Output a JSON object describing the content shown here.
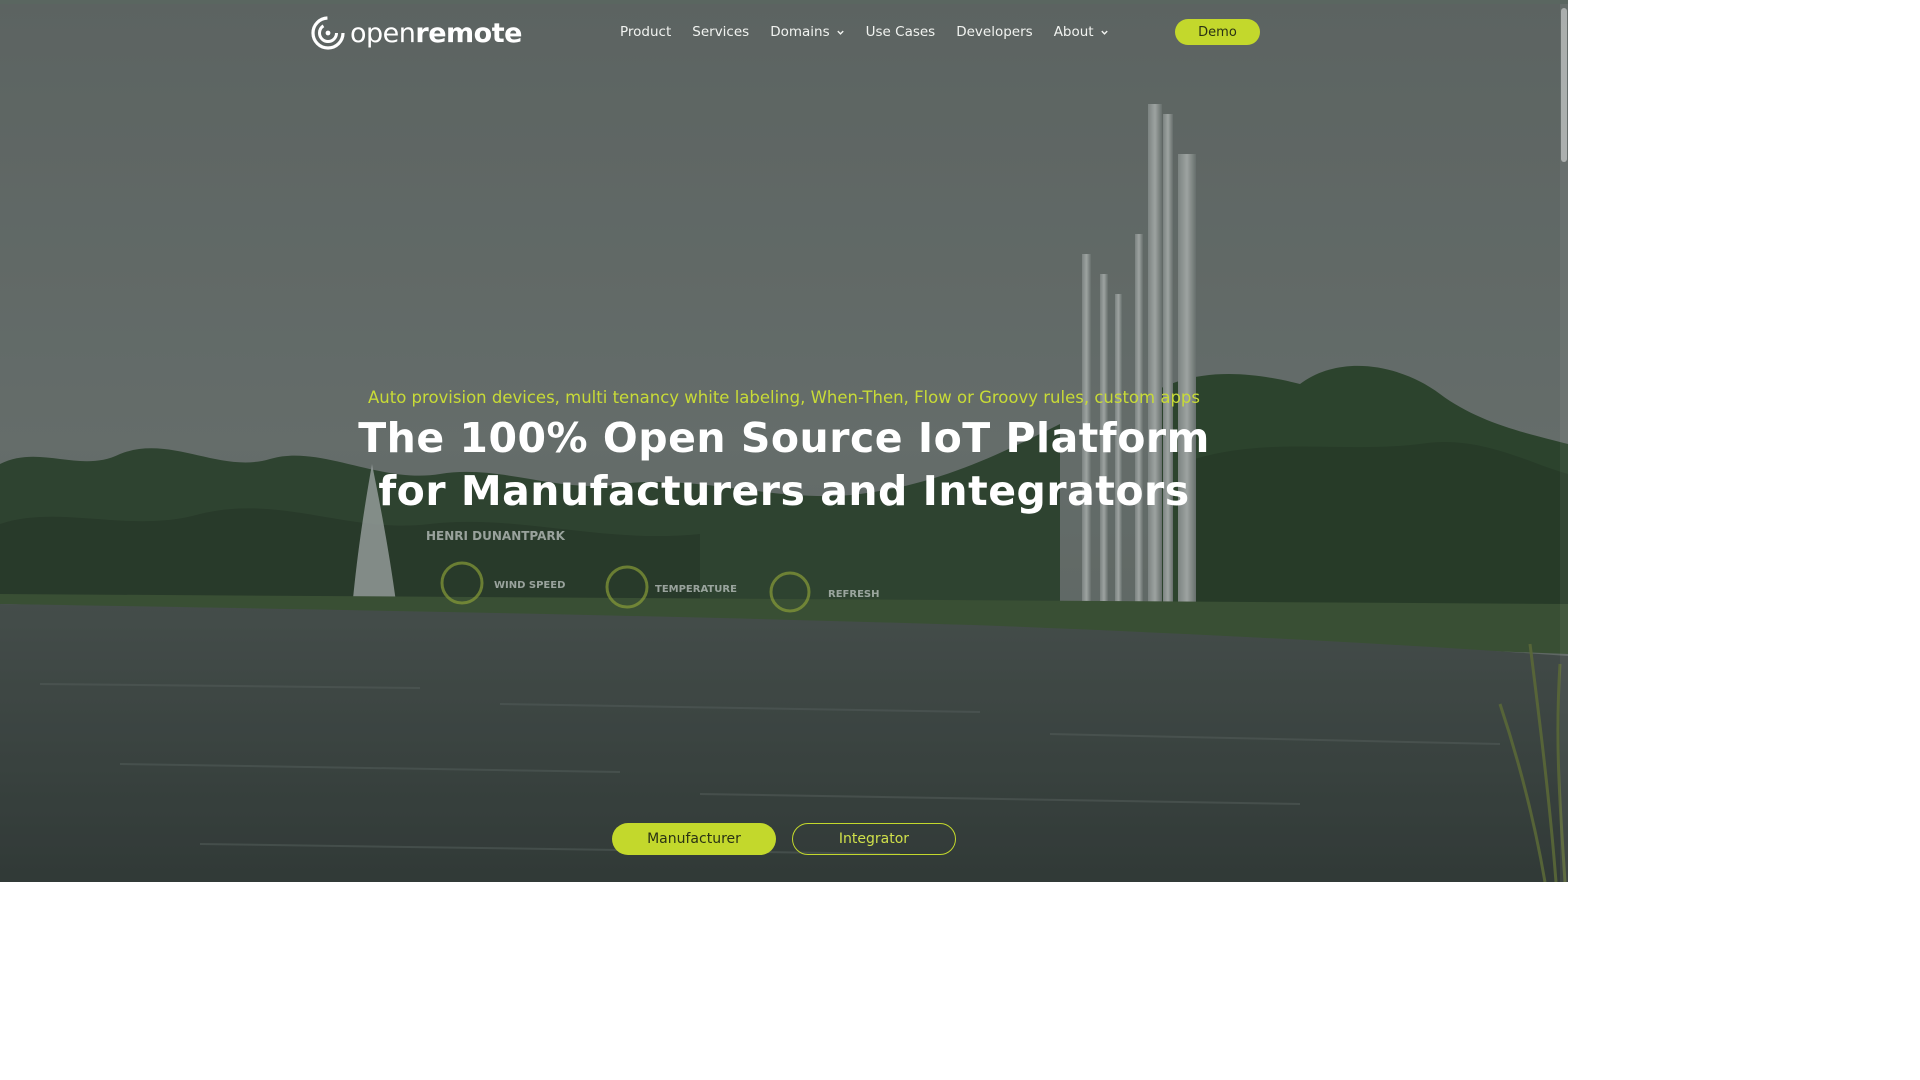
{
  "header": {
    "logo": {
      "light": "open",
      "bold": "remote"
    },
    "nav": [
      {
        "label": "Product",
        "has_dropdown": false
      },
      {
        "label": "Services",
        "has_dropdown": false
      },
      {
        "label": "Domains",
        "has_dropdown": true
      },
      {
        "label": "Use Cases",
        "has_dropdown": false
      },
      {
        "label": "Developers",
        "has_dropdown": false
      },
      {
        "label": "About",
        "has_dropdown": true
      }
    ],
    "demo_label": "Demo"
  },
  "hero": {
    "tagline": "Auto provision devices, multi tenancy white labeling, When-Then, Flow or Groovy rules, custom apps",
    "headline_line1": "The 100% Open Source IoT Platform",
    "headline_line2": "for Manufacturers and Integrators",
    "background_overlay": {
      "park_label": "HENRI DUNANTPARK",
      "widgets": [
        "WIND SPEED",
        "TEMPERATURE",
        "REFRESH"
      ]
    }
  },
  "cta": {
    "primary_label": "Manufacturer",
    "secondary_label": "Integrator"
  },
  "colors": {
    "accent": "#c3d82c",
    "text": "#ffffff"
  }
}
